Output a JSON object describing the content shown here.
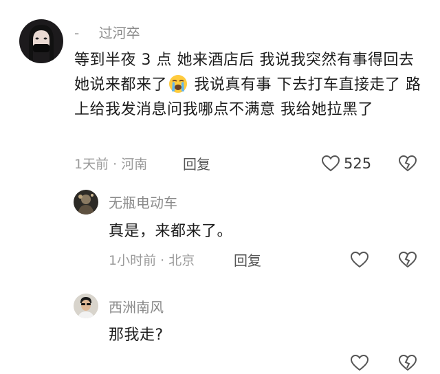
{
  "comments": [
    {
      "username": "过河卒",
      "username_prefix": "-",
      "text_part1": "等到半夜 3 点   她来酒店后   我说我突然有事得回去   她说来都来了",
      "emoji_name": "loudly-crying-face-emoji",
      "text_part2": "   我说真有事   下去打车直接走了   路上给我发消息问我哪点不满意   我给她拉黑了",
      "meta": "1天前 · 河南",
      "reply_label": "回复",
      "like_count": "525"
    },
    {
      "username": "无瓶电动车",
      "text": "真是，来都来了。",
      "meta": "1小时前 · 北京",
      "reply_label": "回复"
    },
    {
      "username": "西洲南风",
      "text": "那我走?"
    }
  ],
  "colors": {
    "username": "#8a8a8a",
    "meta": "#9a9a9a",
    "text": "#1c1c1c",
    "icon": "#555555"
  }
}
